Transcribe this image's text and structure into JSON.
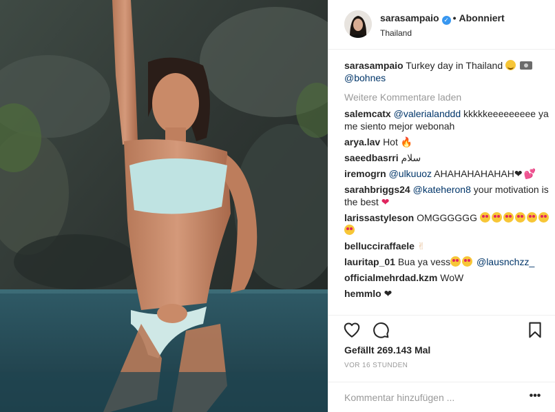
{
  "post": {
    "username": "sarasampaio",
    "follow_status": "Abonniert",
    "location": "Thailand",
    "caption": {
      "user": "sarasampaio",
      "text": "Turkey day in Thailand",
      "mention": "@bohnes"
    },
    "load_more": "Weitere Kommentare laden",
    "likes": "Gefällt 269.143 Mal",
    "time": "VOR 16 STUNDEN",
    "add_comment_placeholder": "Kommentar hinzufügen ...",
    "more_label": "•••"
  },
  "comments": [
    {
      "user": "salemcatx",
      "mention": "@valerialanddd",
      "text": "kkkkkeeeeeeeee ya me siento mejor webonah"
    },
    {
      "user": "arya.lav",
      "text": "Hot"
    },
    {
      "user": "saeedbasrri",
      "text": "سلام"
    },
    {
      "user": "iremogrn",
      "mention": "@ulkuuoz",
      "text": "AHAHAHAHAHAH"
    },
    {
      "user": "sarahbriggs24",
      "mention": "@kateheron8",
      "text": "your motivation is the best"
    },
    {
      "user": "larissastyleson",
      "text": "OMGGGGGG"
    },
    {
      "user": "bellucciraffaele",
      "text": ""
    },
    {
      "user": "lauritap_01",
      "text": "Bua ya vess",
      "mention": "@lausnchzz_"
    },
    {
      "user": "officialmehrdad.kzm",
      "text": "WoW"
    },
    {
      "user": "hemmlo",
      "text": ""
    }
  ],
  "icons": {
    "like": "heart-outline-icon",
    "comment": "speech-bubble-icon",
    "save": "bookmark-icon",
    "verified": "verified-badge-icon"
  },
  "colors": {
    "verified": "#3897f0",
    "mention": "#003569",
    "muted": "#999999",
    "border": "#efefef"
  }
}
